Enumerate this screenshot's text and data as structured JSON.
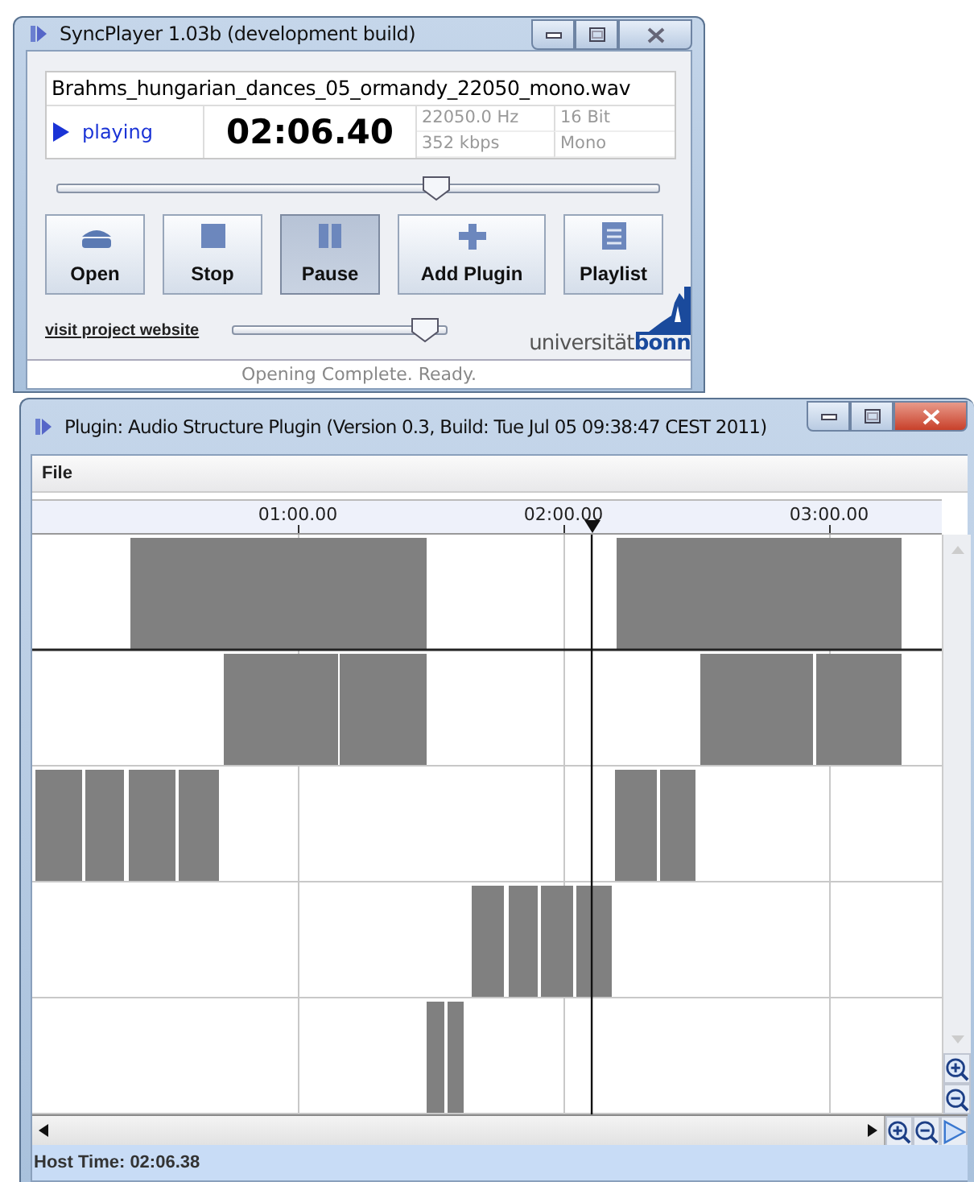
{
  "player": {
    "title": "SyncPlayer 1.03b (development build)",
    "file_name": "Brahms_hungarian_dances_05_ormandy_22050_mono.wav",
    "state": "playing",
    "time": "02:06.40",
    "sample_rate": "22050.0 Hz",
    "bit_depth": "16 Bit",
    "bitrate": "352 kbps",
    "channels": "Mono",
    "position": {
      "level": 0.63
    },
    "buttons": [
      {
        "label": "Open",
        "kind": "open",
        "selected": false
      },
      {
        "label": "Stop",
        "kind": "stop",
        "selected": false
      },
      {
        "label": "Pause",
        "kind": "pause",
        "selected": true
      },
      {
        "label": "Add Plugin",
        "kind": "add",
        "selected": false
      },
      {
        "label": "Playlist",
        "kind": "playlist",
        "selected": false
      }
    ],
    "link": "visit project website",
    "volume": {
      "level": 0.9
    },
    "logo": {
      "light": "universität",
      "bold": "bonn"
    },
    "status_bar": "Opening Complete. Ready."
  },
  "plugin": {
    "title": "Plugin: Audio Structure Plugin (Version 0.3, Build: Tue Jul 05 09:38:47 CEST 2011)",
    "menu": [
      "File"
    ],
    "ruler": [
      "01:00.00",
      "02:00.00",
      "03:00.00"
    ],
    "status_bar": "Host Time: 02:06.38"
  }
}
